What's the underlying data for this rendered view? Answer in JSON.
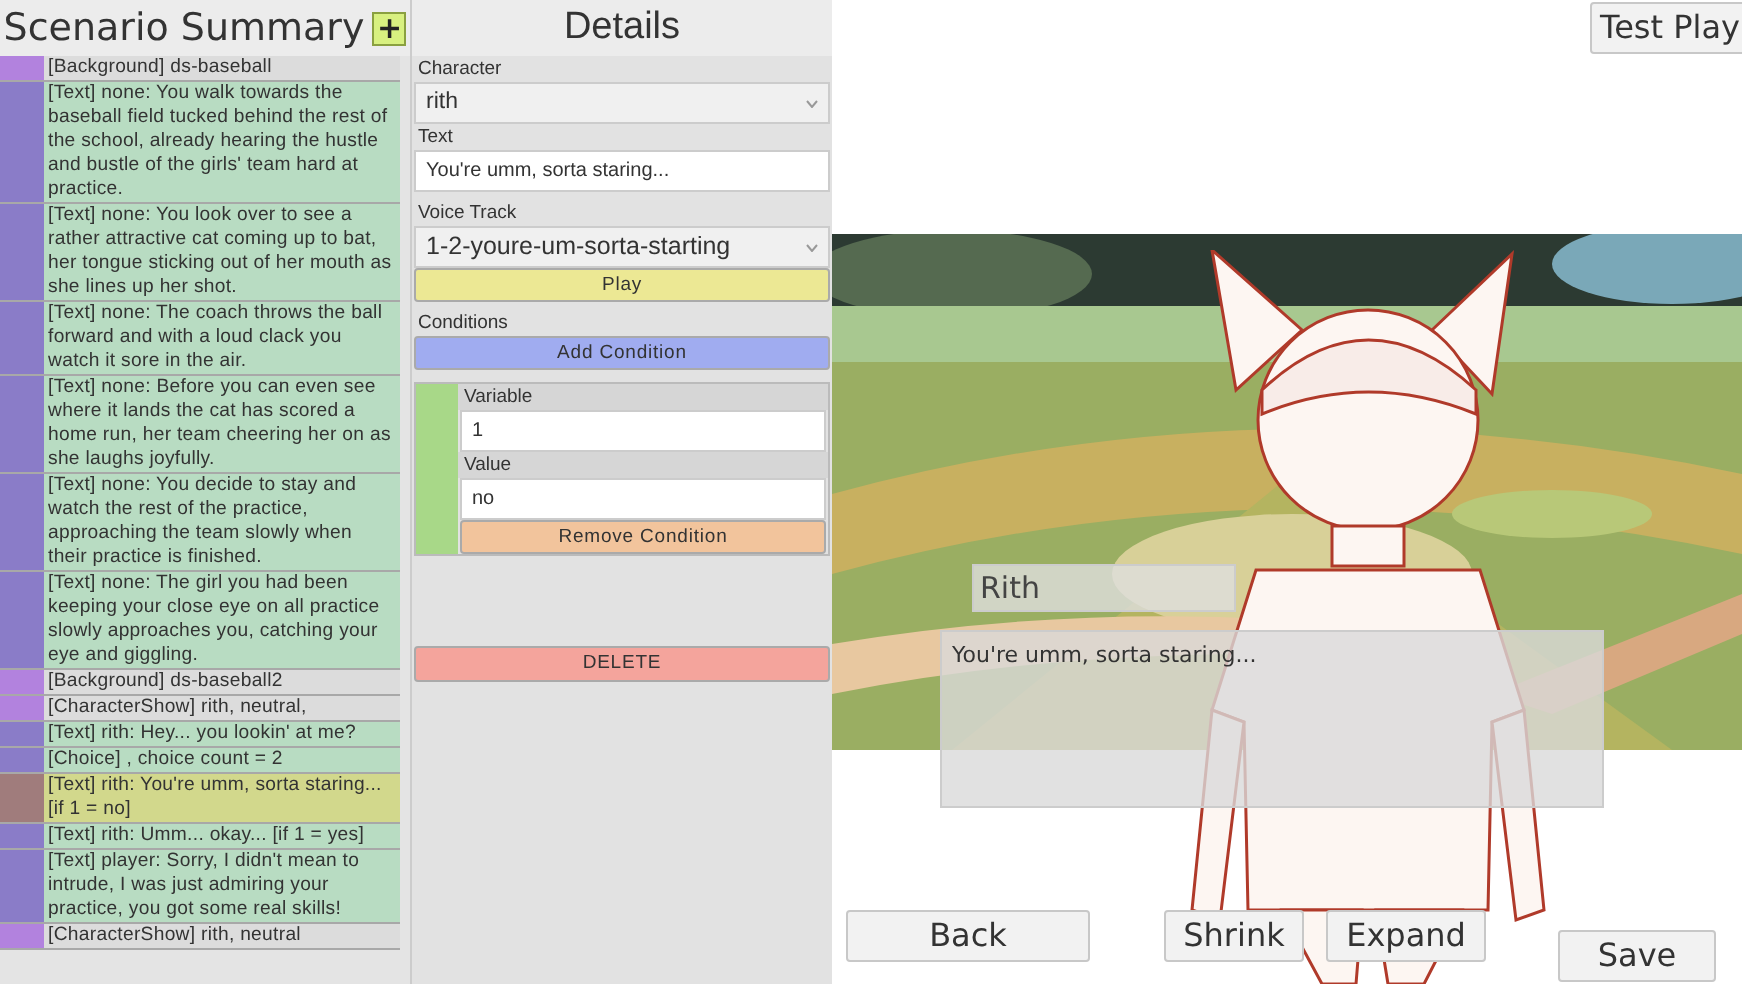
{
  "scenario": {
    "title": "Scenario Summary",
    "add_button": "+",
    "events": [
      {
        "kind": "background",
        "selected": false,
        "text": "[Background] ds-baseball"
      },
      {
        "kind": "text",
        "selected": false,
        "text": "[Text] none: You walk towards the baseball field tucked behind the rest of the school, already hearing the hustle and bustle of the girls' team hard at practice."
      },
      {
        "kind": "text",
        "selected": false,
        "text": "[Text] none: You look over to see a rather attractive cat coming up to bat, her tongue sticking out of her mouth as she lines up her shot."
      },
      {
        "kind": "text",
        "selected": false,
        "text": "[Text] none: The coach throws the ball forward and with a loud clack you watch it sore in the air."
      },
      {
        "kind": "text",
        "selected": false,
        "text": "[Text] none: Before you can even see where it lands the cat has scored a home run, her team cheering her on as she laughs joyfully."
      },
      {
        "kind": "text",
        "selected": false,
        "text": "[Text] none: You decide to stay and watch the rest of the practice, approaching the team slowly when their practice is finished."
      },
      {
        "kind": "text",
        "selected": false,
        "text": "[Text] none: The girl you had been keeping your close eye on all practice slowly approaches you, catching your eye and giggling."
      },
      {
        "kind": "background",
        "selected": false,
        "text": "[Background] ds-baseball2"
      },
      {
        "kind": "background",
        "selected": false,
        "text": "[CharacterShow] rith, neutral,"
      },
      {
        "kind": "text",
        "selected": false,
        "text": "[Text] rith: Hey... you lookin' at me?"
      },
      {
        "kind": "text",
        "selected": false,
        "text": "[Choice] , choice count = 2"
      },
      {
        "kind": "text",
        "selected": true,
        "text": "[Text] rith: You're umm, sorta staring... [if 1 = no]"
      },
      {
        "kind": "text",
        "selected": false,
        "text": "[Text] rith: Umm... okay... [if 1 = yes]"
      },
      {
        "kind": "text",
        "selected": false,
        "text": "[Text] player: Sorry, I didn't mean to intrude, I was just admiring your practice, you got some real skills!"
      },
      {
        "kind": "background",
        "selected": false,
        "text": "[CharacterShow] rith, neutral"
      }
    ]
  },
  "details": {
    "title": "Details",
    "character_label": "Character",
    "character": "rith",
    "text_label": "Text",
    "text": "You're umm, sorta staring...",
    "voice_label": "Voice Track",
    "voice": "1-2-youre-um-sorta-starting",
    "play": "Play",
    "conditions_label": "Conditions",
    "add_condition": "Add Condition",
    "conditions": [
      {
        "variable_label": "Variable",
        "variable": "1",
        "value_label": "Value",
        "value": "no",
        "remove": "Remove Condition"
      }
    ],
    "delete": "DELETE"
  },
  "preview": {
    "test_play": "Test Play",
    "speaker": "Rith",
    "line": "You're umm, sorta staring...",
    "buttons": [
      "Back",
      "Shrink",
      "Expand",
      "Save"
    ]
  }
}
